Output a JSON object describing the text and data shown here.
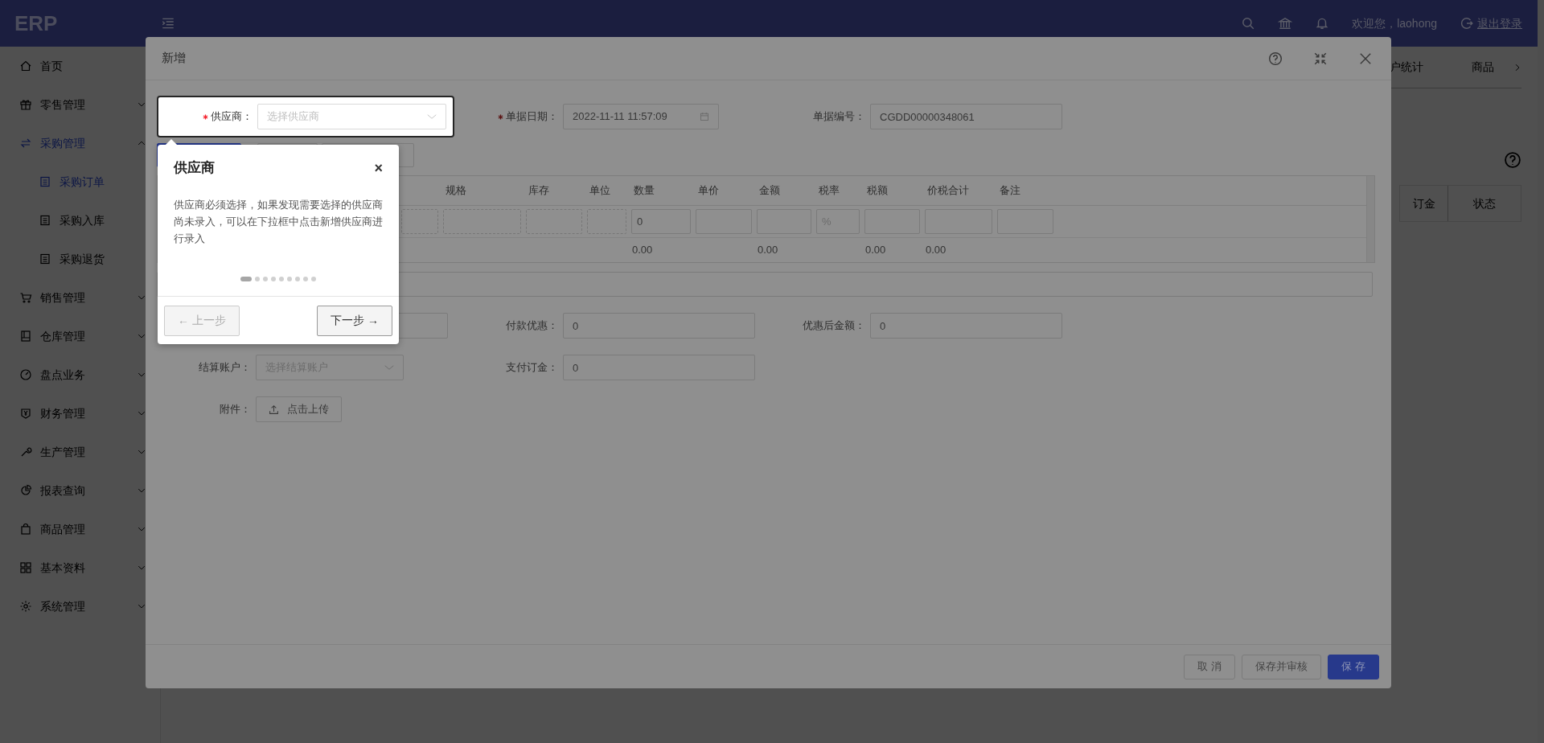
{
  "header": {
    "logo": "ERP",
    "welcome": "欢迎您，laohong",
    "logout": "退出登录"
  },
  "sidebar": {
    "items": [
      {
        "label": "首页",
        "kind": "link",
        "selected": false
      },
      {
        "label": "零售管理",
        "kind": "group",
        "expanded": false,
        "selected": false
      },
      {
        "label": "采购管理",
        "kind": "group",
        "expanded": true,
        "selected": false,
        "children": [
          {
            "label": "采购订单",
            "selected": true
          },
          {
            "label": "采购入库",
            "selected": false
          },
          {
            "label": "采购退货",
            "selected": false
          }
        ]
      },
      {
        "label": "销售管理",
        "kind": "group",
        "expanded": false,
        "selected": false
      },
      {
        "label": "仓库管理",
        "kind": "group",
        "expanded": false,
        "selected": false
      },
      {
        "label": "盘点业务",
        "kind": "group",
        "expanded": false,
        "selected": false
      },
      {
        "label": "财务管理",
        "kind": "group",
        "expanded": false,
        "selected": false
      },
      {
        "label": "生产管理",
        "kind": "group",
        "expanded": false,
        "selected": false
      },
      {
        "label": "报表查询",
        "kind": "group",
        "expanded": false,
        "selected": false
      },
      {
        "label": "商品管理",
        "kind": "group",
        "expanded": false,
        "selected": false
      },
      {
        "label": "基本资料",
        "kind": "group",
        "expanded": false,
        "selected": false
      },
      {
        "label": "系统管理",
        "kind": "group",
        "expanded": false,
        "selected": false
      }
    ]
  },
  "background_page": {
    "tabs": [
      "户统计",
      "商品"
    ],
    "table_columns": [
      "订金",
      "状态"
    ]
  },
  "modal": {
    "title": "新增",
    "top_fields": [
      {
        "kind": "select",
        "label": "供应商：",
        "required": true,
        "highlighted": true,
        "placeholder": "选择供应商"
      },
      {
        "kind": "date",
        "label": "单据日期：",
        "required": true,
        "highlighted": false,
        "value": "2022-11-11 11:57:09"
      },
      {
        "kind": "input",
        "label": "单据编号：",
        "required": false,
        "highlighted": false,
        "value": "CGDD00000348061"
      }
    ],
    "toolbar": [
      {
        "kind": "primary"
      },
      {
        "kind": "default"
      },
      {
        "kind": "default"
      }
    ],
    "table": {
      "columns": [
        {
          "label": "规格",
          "kind": "dashed"
        },
        {
          "label": "库存",
          "kind": "dashed"
        },
        {
          "label": "单位",
          "kind": "dashed"
        },
        {
          "label": "数量",
          "kind": "input",
          "value": "0",
          "total": "0.00"
        },
        {
          "label": "单价",
          "kind": "input"
        },
        {
          "label": "金额",
          "kind": "input",
          "total": "0.00"
        },
        {
          "label": "税率",
          "kind": "input",
          "placeholder": "%"
        },
        {
          "label": "税额",
          "kind": "input",
          "total": "0.00"
        },
        {
          "label": "价税合计",
          "kind": "input",
          "total": "0.00"
        },
        {
          "label": "备注",
          "kind": "input"
        }
      ]
    },
    "bottom_rows": [
      [
        {
          "kind": "input",
          "required": false,
          "highlighted": false
        },
        {
          "kind": "input",
          "label": "付款优惠：",
          "required": false,
          "highlighted": false,
          "value": "0"
        },
        {
          "kind": "input",
          "label": "优惠后金额：",
          "required": false,
          "highlighted": false,
          "value": "0"
        }
      ],
      [
        {
          "kind": "select",
          "label": "结算账户：",
          "required": false,
          "highlighted": false,
          "placeholder": "选择结算账户"
        },
        {
          "kind": "input",
          "label": "支付订金：",
          "required": false,
          "highlighted": false,
          "value": "0"
        }
      ],
      [
        {
          "kind": "upload",
          "label": "附件：",
          "required": false,
          "highlighted": false,
          "button": "点击上传"
        }
      ]
    ],
    "footer_buttons": [
      {
        "label": "取 消",
        "kind": "default"
      },
      {
        "label": "保存并审核",
        "kind": "default"
      },
      {
        "label": "保 存",
        "kind": "primary"
      }
    ]
  },
  "tour": {
    "title": "供应商",
    "close": "×",
    "text": "供应商必须选择，如果发现需要选择的供应商尚未录入，可以在下拉框中点击新增供应商进行录入",
    "steps": [
      {
        "selected": true
      },
      {
        "selected": false
      },
      {
        "selected": false
      },
      {
        "selected": false
      },
      {
        "selected": false
      },
      {
        "selected": false
      },
      {
        "selected": false
      },
      {
        "selected": false
      },
      {
        "selected": false
      }
    ],
    "prev": {
      "label": "← 上一步",
      "disabled": true
    },
    "next": {
      "label": "下一步 →",
      "disabled": false
    }
  }
}
